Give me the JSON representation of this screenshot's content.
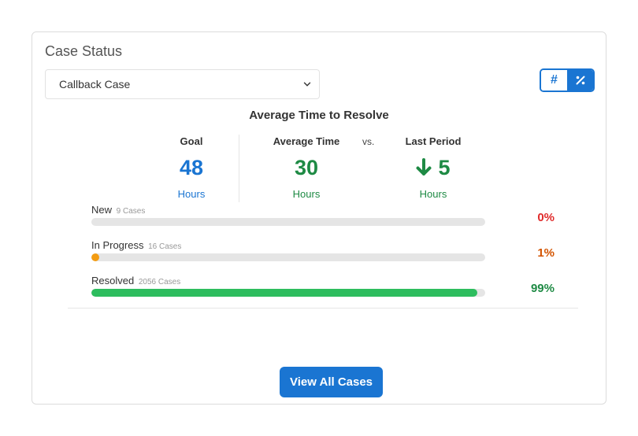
{
  "card": {
    "title": "Case Status",
    "select": {
      "value": "Callback Case",
      "icon": "chevron-down-icon"
    },
    "toggle": {
      "count_label": "#",
      "percent_label": "%"
    },
    "section_title": "Average Time to Resolve",
    "metrics": {
      "goal": {
        "label": "Goal",
        "value": "48",
        "unit": "Hours",
        "color": "#1a75d2"
      },
      "average": {
        "label": "Average Time",
        "value": "30",
        "unit": "Hours",
        "color": "#1e8a44"
      },
      "vs": "vs.",
      "last_period": {
        "label": "Last Period",
        "value": "5",
        "unit": "Hours",
        "trend_icon": "arrow-down-icon",
        "color": "#1e8a44"
      }
    },
    "status_rows": [
      {
        "label": "New",
        "count": "9 Cases",
        "percent_text": "0%",
        "fraction": 0.0,
        "bar_color": "#e5e5e5",
        "pct_color": "#e02b2b"
      },
      {
        "label": "In Progress",
        "count": "16 Cases",
        "percent_text": "1%",
        "fraction": 0.01,
        "bar_color": "#f39c12",
        "pct_color": "#d35400"
      },
      {
        "label": "Resolved",
        "count": "2056 Cases",
        "percent_text": "99%",
        "fraction": 0.98,
        "bar_color": "#2dbd5e",
        "pct_color": "#1e8a44"
      }
    ],
    "view_all_button": "View All Cases"
  }
}
